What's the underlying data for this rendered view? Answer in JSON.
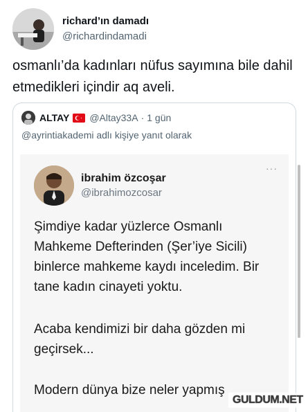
{
  "tweet": {
    "display_name": "richard’ın damadı",
    "handle": "@richardindamadi",
    "text": "osmanlı’da kadınları nüfus sayımına bile dahil etmedikleri içindir aq aveli."
  },
  "quote": {
    "display_name": "ALTAY",
    "handle": "@Altay33A",
    "separator": "·",
    "time": "1 gün",
    "reply_to": "@ayrintiakademi adlı kişiye yanıt olarak",
    "embedded": {
      "display_name": "ibrahim özcoşar",
      "handle": "@ibrahimozcosar",
      "more": "···",
      "paragraph_1": "Şimdiye kadar yüzlerce Osmanlı Mahkeme Defterinden (Şer’iye Sicili) binlerce mahkeme kaydı inceledim. Bir tane kadın cinayeti yoktu.",
      "paragraph_2": "Acaba kendimizi bir daha gözden mi geçirsek...",
      "paragraph_3": "Modern dünya bize neler yapmış"
    }
  },
  "watermark": "GULDUM.NET",
  "colors": {
    "text": "#0f1419",
    "secondary": "#536471",
    "border": "#cfd9de",
    "flag_red": "#e30a17"
  },
  "icons": [
    "turkey-flag-icon",
    "more-options-icon"
  ]
}
